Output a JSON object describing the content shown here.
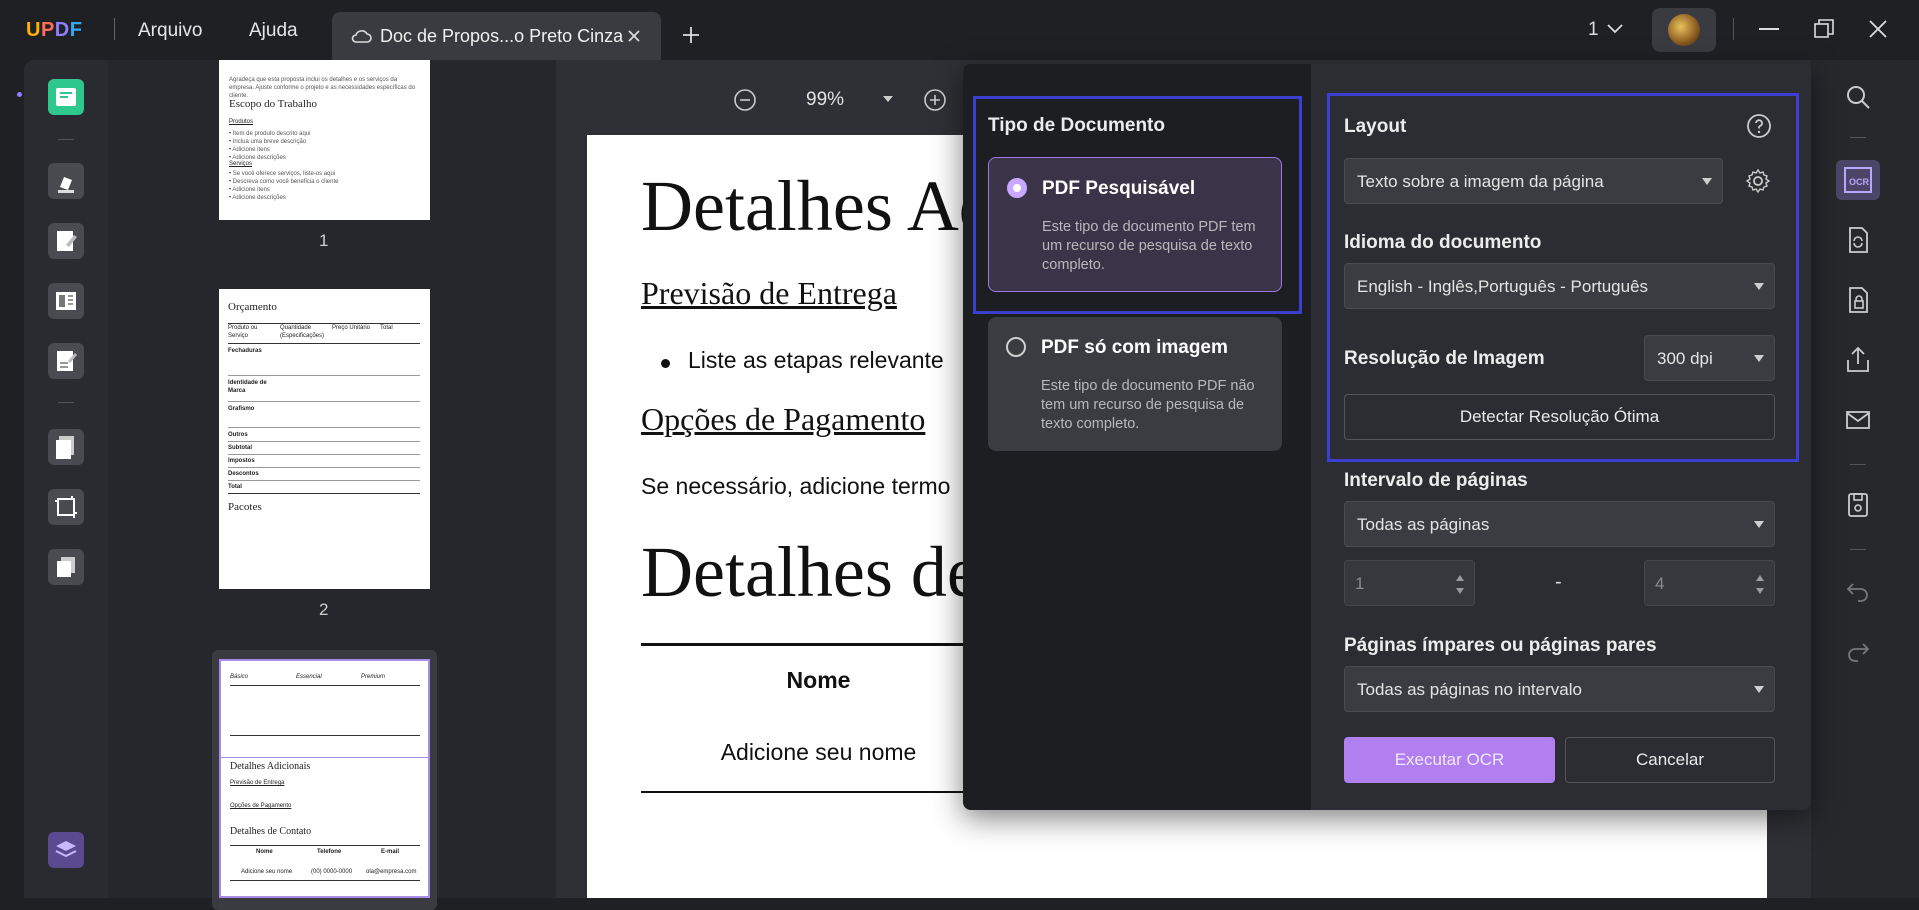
{
  "app": {
    "logo": "UPDF",
    "menu": [
      "Arquivo",
      "Ajuda"
    ],
    "page_counter": "1"
  },
  "tab": {
    "title": "Doc de Propos...o Preto Cinza"
  },
  "thumbnails": {
    "pages": [
      "1",
      "2"
    ],
    "p1": {
      "title": "Escopo do Trabalho",
      "sub1": "Produtos",
      "sub2": "Serviços"
    },
    "p2": {
      "title": "Orçamento",
      "headers": [
        "Produto ou Serviço",
        "Quantidade (Especificações)",
        "Preço Unitário",
        "Total"
      ],
      "rows": [
        "Fechaduras",
        "Identidade de Marca",
        "Grafismo",
        "Outros",
        "Subtotal",
        "Impostos",
        "Descontos",
        "Total"
      ],
      "subtitle": "Pacotes"
    },
    "p3": {
      "cols": [
        "Básico",
        "Essencial",
        "Premium"
      ],
      "title1": "Detalhes Adicionais",
      "link1": "Previsão de Entrega",
      "link2": "Opções de Pagamento",
      "title2": "Detalhes de Contato",
      "th": [
        "Nome",
        "Telefone",
        "E-mail"
      ],
      "td": [
        "Adicione seu nome",
        "(00) 0000-0000",
        "ola@empresa.com"
      ]
    }
  },
  "toolbar": {
    "zoom": "99%"
  },
  "document": {
    "heading1": "Detalhes Ad",
    "link1": "Previsão de Entrega",
    "bullet": "Liste as etapas relevante",
    "link2": "Opções de Pagamento",
    "para": "Se necessário, adicione termo",
    "heading2": "Detalhes de",
    "table_header": "Nome",
    "table_cell": "Adicione seu nome"
  },
  "ocr": {
    "doc_type_label": "Tipo de Documento",
    "opt1": {
      "title": "PDF Pesquisável",
      "desc": "Este tipo de documento PDF tem um recurso de pesquisa de texto completo.",
      "selected": true
    },
    "opt2": {
      "title": "PDF só com imagem",
      "desc": "Este tipo de documento PDF não tem um recurso de pesquisa de texto completo.",
      "selected": false
    },
    "layout_label": "Layout",
    "layout_value": "Texto sobre a imagem da página",
    "language_label": "Idioma do documento",
    "language_value": "English - Inglês,Português - Português",
    "resolution_label": "Resolução de Imagem",
    "resolution_value": "300 dpi",
    "detect_button": "Detectar Resolução Ótima",
    "range_label": "Intervalo de páginas",
    "range_value": "Todas as páginas",
    "range_from": "1",
    "range_dash": "-",
    "range_to": "4",
    "parity_label": "Páginas ímpares ou páginas pares",
    "parity_value": "Todas as páginas no intervalo",
    "run_button": "Executar OCR",
    "cancel_button": "Cancelar"
  },
  "colors": {
    "accent": "#b17ff0",
    "highlight_border": "#3a3fd1",
    "brand_green": "#27c28a"
  }
}
